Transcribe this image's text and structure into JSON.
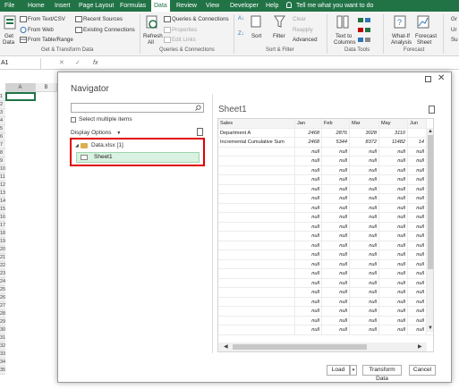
{
  "menu": {
    "tabs": [
      "File",
      "Home",
      "Insert",
      "Page Layout",
      "Formulas",
      "Data",
      "Review",
      "View",
      "Developer",
      "Help"
    ],
    "active_tab": "Data",
    "tell_me": "Tell me what you want to do"
  },
  "ribbon": {
    "get_data": [
      "Get",
      "Data"
    ],
    "from_text_csv": "From Text/CSV",
    "from_web": "From Web",
    "from_table_range": "From Table/Range",
    "recent_sources": "Recent Sources",
    "existing_connections": "Existing Connections",
    "group_get_transform": "Get & Transform Data",
    "refresh_all": [
      "Refresh",
      "All"
    ],
    "queries_connections": "Queries & Connections",
    "properties": "Properties",
    "edit_links": "Edit Links",
    "group_queries": "Queries & Connections",
    "sort": "Sort",
    "filter": "Filter",
    "clear": "Clear",
    "reapply": "Reapply",
    "advanced": "Advanced",
    "group_sort_filter": "Sort & Filter",
    "text_to_columns": [
      "Text to",
      "Columns"
    ],
    "group_data_tools": "Data Tools",
    "what_if": [
      "What-If",
      "Analysis"
    ],
    "forecast_sheet": [
      "Forecast",
      "Sheet"
    ],
    "group_forecast": "Forecast",
    "right_edge": [
      "Gr",
      "Ur",
      "Su"
    ]
  },
  "formula_bar": {
    "name_box": "A1",
    "fx": "fx"
  },
  "sheet": {
    "columns": [
      "A",
      "B"
    ],
    "rows": [
      "1",
      "2",
      "3",
      "4",
      "5",
      "6",
      "7",
      "8",
      "9",
      "10",
      "11",
      "12",
      "13",
      "14",
      "15",
      "16",
      "17",
      "18",
      "19",
      "20",
      "21",
      "22",
      "23",
      "24",
      "25",
      "26",
      "27",
      "28",
      "29",
      "30",
      "31",
      "32",
      "33",
      "34",
      "35"
    ]
  },
  "dialog": {
    "title": "Navigator",
    "select_multiple": "Select multiple items",
    "display_options": "Display Options",
    "tree_file": "Data.xlsx [1]",
    "tree_sheet": "Sheet1",
    "preview_title": "Sheet1",
    "buttons": {
      "load": "Load",
      "transform": "Transform Data",
      "cancel": "Cancel"
    }
  },
  "preview": {
    "headers": [
      "Sales",
      "Jan",
      "Feb",
      "Mar",
      "May",
      "Jun"
    ],
    "rows": [
      [
        "Department A",
        "2468",
        "2876",
        "3028",
        "3110",
        ""
      ],
      [
        "Incremental Cumulative Sum",
        "2468",
        "5344",
        "8372",
        "11482",
        "14"
      ]
    ],
    "null_text": "null",
    "null_row_count": 20
  }
}
